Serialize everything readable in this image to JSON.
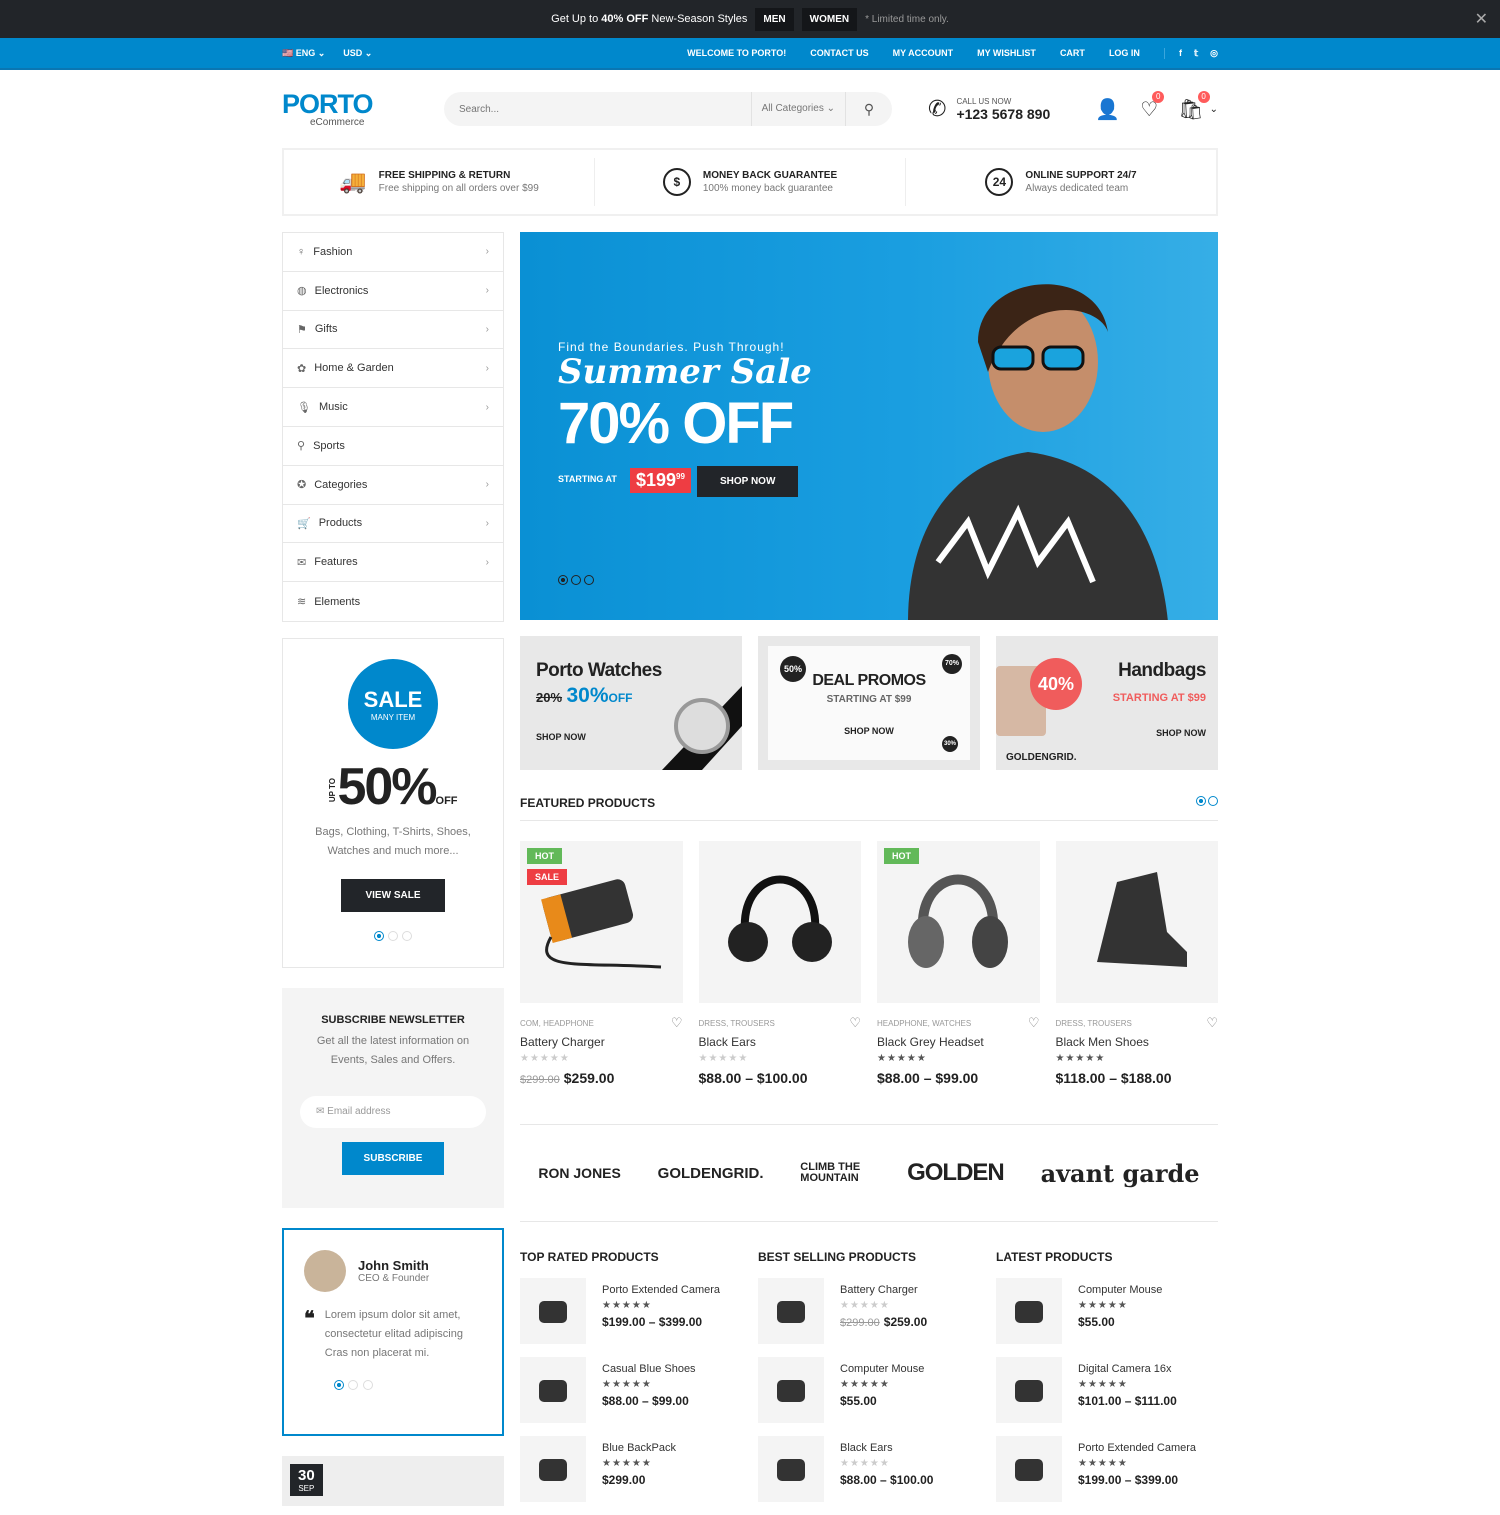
{
  "promo": {
    "text1": "Get Up to ",
    "text2": "40% OFF",
    "text3": " New-Season Styles",
    "men": "MEN",
    "women": "WOMEN",
    "note": "* Limited time only.",
    "close_icon": "close-icon"
  },
  "nav": {
    "language": "ENG",
    "currency": "USD",
    "links": [
      "WELCOME TO PORTO!",
      "CONTACT US",
      "MY ACCOUNT",
      "MY WISHLIST",
      "CART",
      "LOG IN"
    ],
    "social": [
      "facebook-icon",
      "twitter-icon",
      "instagram-icon"
    ]
  },
  "header": {
    "logo": "PORTO",
    "logo_sub": "eCommerce",
    "search_placeholder": "Search...",
    "category": "All Categories",
    "call_label": "CALL US NOW",
    "phone": "+123 5678 890",
    "wishlist_count": "0",
    "cart_count": "0"
  },
  "features": [
    {
      "title": "FREE SHIPPING & RETURN",
      "desc": "Free shipping on all orders over $99",
      "icon": "truck-icon"
    },
    {
      "title": "MONEY BACK GUARANTEE",
      "desc": "100% money back guarantee",
      "icon": "dollar-icon"
    },
    {
      "title": "ONLINE SUPPORT 24/7",
      "desc": "Always dedicated team",
      "icon": "support-24-icon"
    }
  ],
  "categories": [
    {
      "label": "Fashion",
      "icon": "dress-icon",
      "arrow": true
    },
    {
      "label": "Electronics",
      "icon": "globe-icon",
      "arrow": true
    },
    {
      "label": "Gifts",
      "icon": "gift-icon",
      "arrow": true
    },
    {
      "label": "Home & Garden",
      "icon": "plant-icon",
      "arrow": true
    },
    {
      "label": "Music",
      "icon": "mic-icon",
      "arrow": true
    },
    {
      "label": "Sports",
      "icon": "racket-icon",
      "arrow": false
    },
    {
      "label": "Categories",
      "icon": "award-icon",
      "arrow": true
    },
    {
      "label": "Products",
      "icon": "cart-icon",
      "arrow": true
    },
    {
      "label": "Features",
      "icon": "mail-icon",
      "arrow": true
    },
    {
      "label": "Elements",
      "icon": "layers-icon",
      "arrow": false
    }
  ],
  "hero": {
    "kicker": "Find the Boundaries. Push Through!",
    "script": "Summer Sale",
    "headline": "70% OFF",
    "starting": "STARTING AT",
    "price": "$199",
    "price_cents": "99",
    "button": "SHOP NOW",
    "slides": 3,
    "active_slide": 1
  },
  "banners": [
    {
      "title": "Porto Watches",
      "old": "20%",
      "new": "30%",
      "off": "OFF",
      "cta": "SHOP NOW"
    },
    {
      "title": "DEAL PROMOS",
      "sub": "STARTING AT $99",
      "cta": "SHOP NOW",
      "b1": "50%",
      "b2": "70%",
      "b3": "30%"
    },
    {
      "title": "Handbags",
      "sub": "STARTING AT $99",
      "cta": "SHOP NOW",
      "pct": "40%",
      "brand": "GOLDENGRID."
    }
  ],
  "featured": {
    "title": "FEATURED PRODUCTS",
    "items": [
      {
        "cat": "COM, HEADPHONE",
        "name": "Battery Charger",
        "rating": 0,
        "old": "$299.00",
        "price": "$259.00",
        "tags": [
          "HOT",
          "SALE"
        ]
      },
      {
        "cat": "DRESS, TROUSERS",
        "name": "Black Ears",
        "rating": 0,
        "old": "",
        "price": "$88.00 – $100.00",
        "tags": []
      },
      {
        "cat": "HEADPHONE, WATCHES",
        "name": "Black Grey Headset",
        "rating": 3.5,
        "old": "",
        "price": "$88.00 – $99.00",
        "tags": [
          "HOT"
        ]
      },
      {
        "cat": "DRESS, TROUSERS",
        "name": "Black Men Shoes",
        "rating": 3.5,
        "old": "",
        "price": "$118.00 – $188.00",
        "tags": []
      }
    ]
  },
  "brands": [
    "RON JONES",
    "GOLDENGRID.",
    "CLIMB THE MOUNTAIN",
    "GOLDEN",
    "avant garde"
  ],
  "lists": [
    {
      "title": "TOP RATED PRODUCTS",
      "items": [
        {
          "name": "Porto Extended Camera",
          "rating": 4.5,
          "old": "",
          "price": "$199.00 – $399.00"
        },
        {
          "name": "Casual Blue Shoes",
          "rating": 4.5,
          "old": "",
          "price": "$88.00 – $99.00"
        },
        {
          "name": "Blue BackPack",
          "rating": 4.5,
          "old": "",
          "price": "$299.00"
        }
      ]
    },
    {
      "title": "BEST SELLING PRODUCTS",
      "items": [
        {
          "name": "Battery Charger",
          "rating": 0,
          "old": "$299.00",
          "price": "$259.00"
        },
        {
          "name": "Computer Mouse",
          "rating": 3.5,
          "old": "",
          "price": "$55.00"
        },
        {
          "name": "Black Ears",
          "rating": 0,
          "old": "",
          "price": "$88.00 – $100.00"
        }
      ]
    },
    {
      "title": "LATEST PRODUCTS",
      "items": [
        {
          "name": "Computer Mouse",
          "rating": 3.5,
          "old": "",
          "price": "$55.00"
        },
        {
          "name": "Digital Camera 16x",
          "rating": 3.5,
          "old": "",
          "price": "$101.00 – $111.00"
        },
        {
          "name": "Porto Extended Camera",
          "rating": 4.5,
          "old": "",
          "price": "$199.00 – $399.00"
        }
      ]
    }
  ],
  "sale": {
    "badge": "SALE",
    "badge_sub": "MANY ITEM",
    "upto": "UP TO",
    "pct": "50%",
    "off": "OFF",
    "desc1": "Bags, Clothing, T-Shirts, Shoes,",
    "desc2": "Watches and much more...",
    "button": "VIEW SALE"
  },
  "newsletter": {
    "title": "SUBSCRIBE NEWSLETTER",
    "desc1": "Get all the latest information on",
    "desc2": "Events, Sales and Offers.",
    "placeholder": "Email address",
    "button": "SUBSCRIBE"
  },
  "testimonial": {
    "name": "John Smith",
    "role": "CEO & Founder",
    "l1": "Lorem ipsum dolor sit amet,",
    "l2": "consectetur elitad adipiscing",
    "l3": "Cras non placerat mi."
  },
  "blog": {
    "day": "30",
    "month": "SEP"
  },
  "colors": {
    "primary": "#0088cc",
    "dark": "#222529",
    "sale": "#ee3d43",
    "hot": "#62b959"
  }
}
